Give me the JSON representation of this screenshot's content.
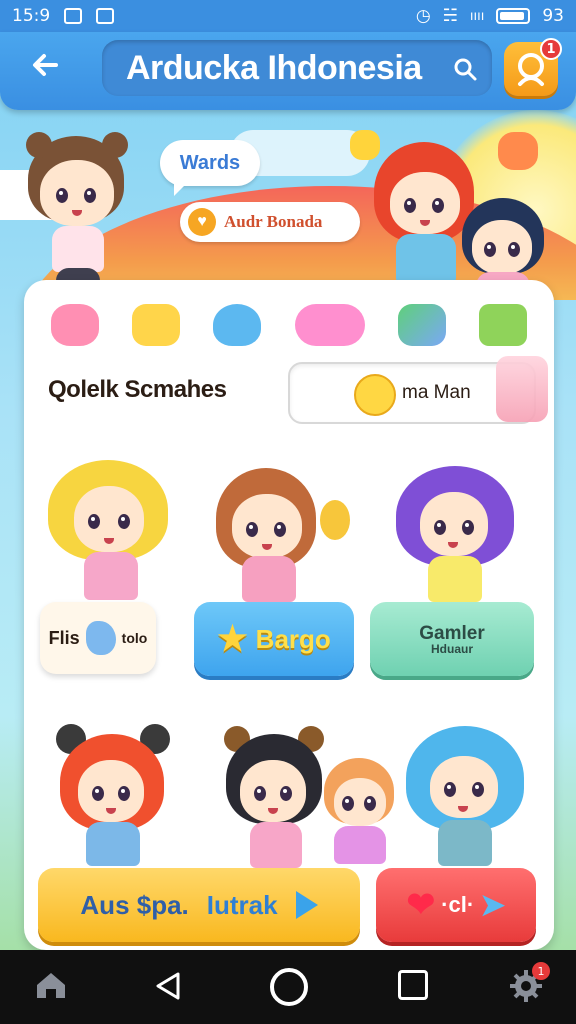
{
  "status_bar": {
    "time": "15:9",
    "badge": "ıııı",
    "battery": "93"
  },
  "header": {
    "back_icon": "arrow-left-icon",
    "title": "Arducka Ihdonesia",
    "search_icon": "search-icon",
    "profile_badge": "1"
  },
  "hero": {
    "bubble_text": "Wards",
    "banner_text": "Audr Bonada"
  },
  "section": {
    "title": "Qolelk Scmahes",
    "search_value": "ma Man"
  },
  "buttons": {
    "grid_left": "Flis",
    "grid_right": "tolo",
    "star_label": "Bargo",
    "game_label": "Gamler",
    "game_sub": "Hduaur",
    "bottom_a": "Aus $pa.",
    "bottom_b": "Iutrak",
    "like_label": "·cl·"
  },
  "colors": {
    "accent": "#3b8fe0",
    "orange": "#f59a18",
    "yellow": "#f9b81f",
    "red": "#e83b3b",
    "teal": "#6fd1b1"
  },
  "navbar": {
    "settings_badge": "1"
  }
}
